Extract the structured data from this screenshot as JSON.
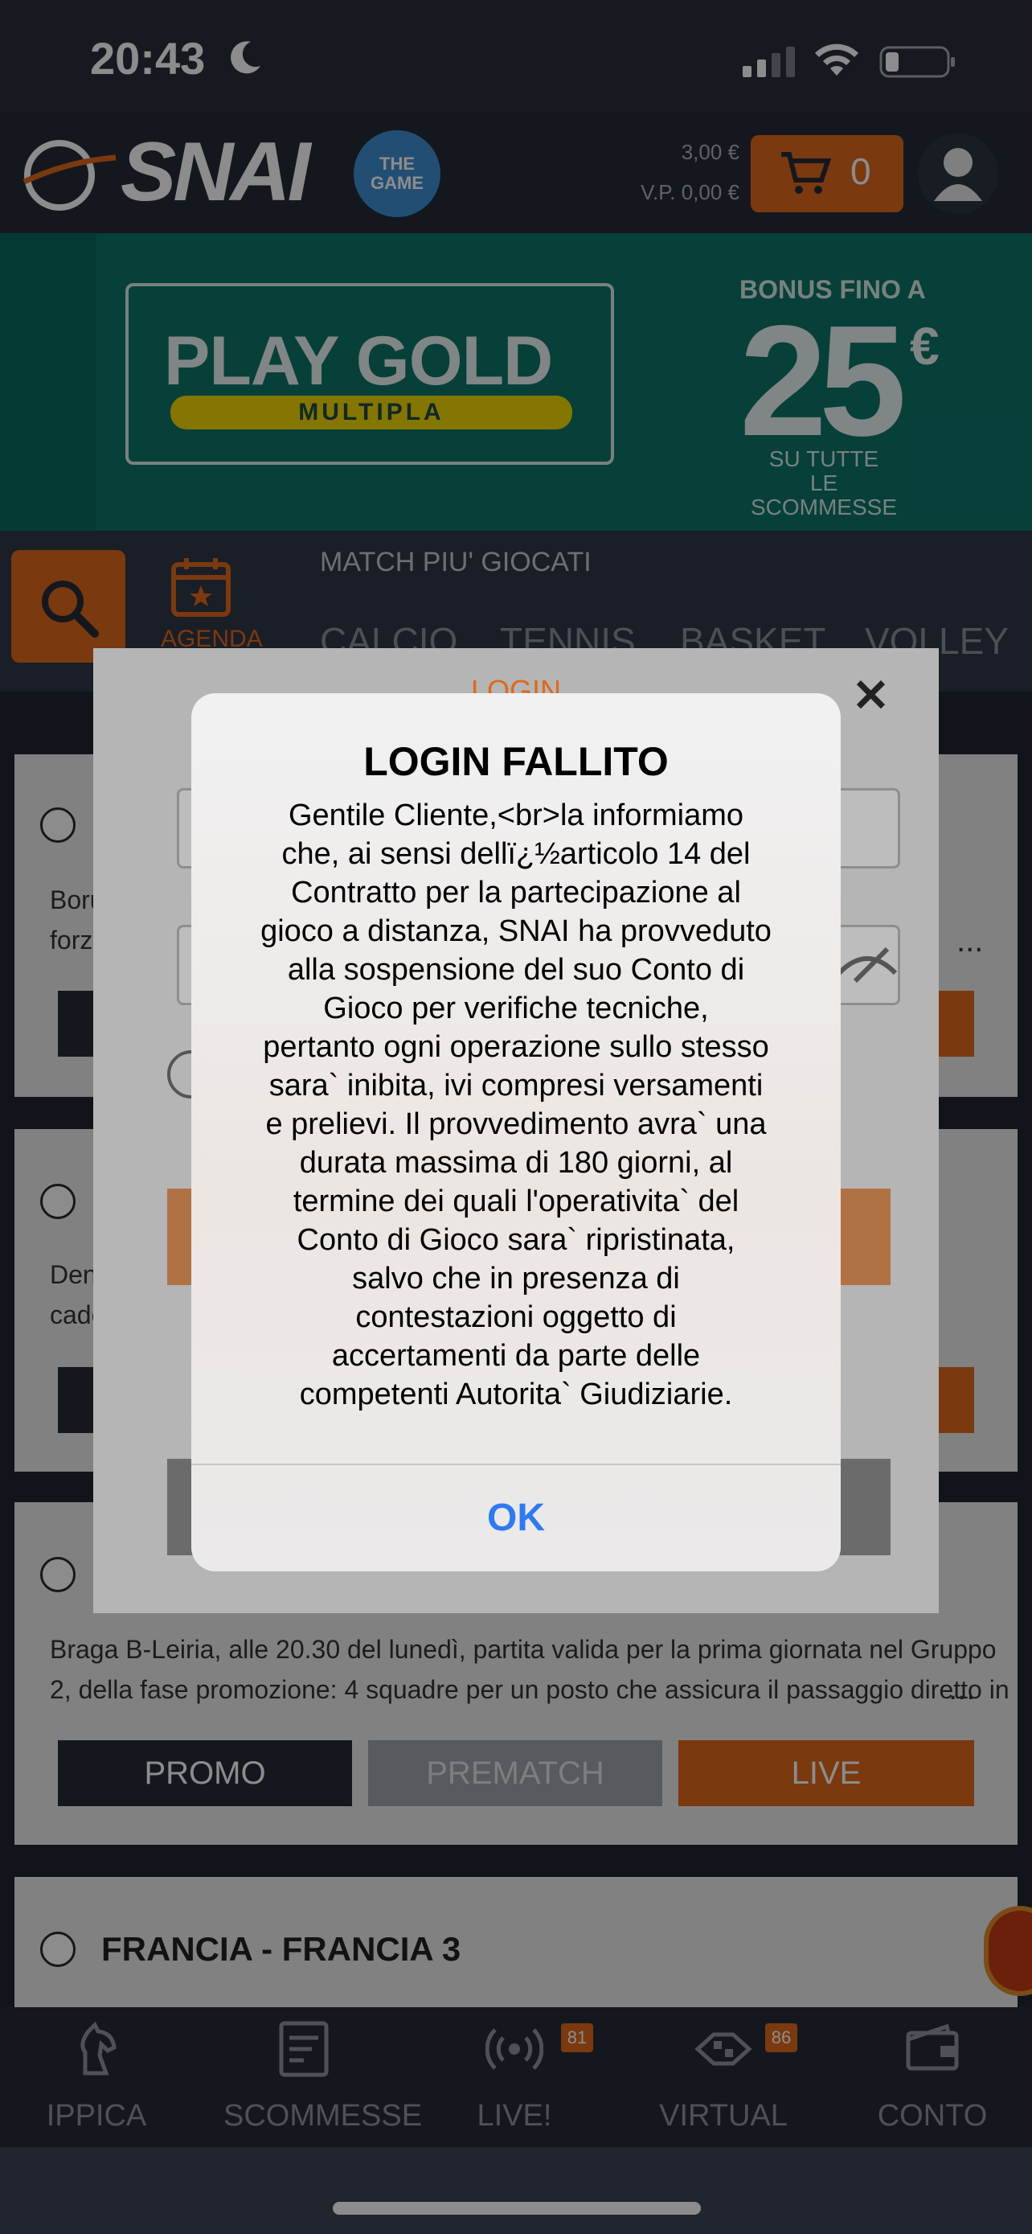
{
  "status_bar": {
    "time": "20:43",
    "moon_icon": "moon-icon",
    "signal_icon": "cellular-signal-icon",
    "wifi_icon": "wifi-icon",
    "battery_icon": "battery-icon"
  },
  "header": {
    "logo_text": "SNAI",
    "game_badge": "THE GAME",
    "balance": "3,00 €",
    "vp_balance": "V.P. 0,00 €",
    "cart_count": "0",
    "accent_color": "#e0681c"
  },
  "banner": {
    "title": "PLAY GOLD",
    "subtitle": "MULTIPLA",
    "bonus_top": "BONUS FINO A",
    "bonus_amount": "25",
    "bonus_currency": "€",
    "bonus_line1": "SU TUTTE",
    "bonus_line2": "LE SCOMMESSE"
  },
  "nav": {
    "agenda_label": "AGENDA",
    "match_label": "MATCH PIU' GIOCATI",
    "sport_tabs": [
      "CALCIO",
      "TENNIS",
      "BASKET",
      "VOLLEY"
    ]
  },
  "cards": [
    {
      "text_line1": "Boru",
      "text_line2": "forza"
    },
    {
      "text_line1": "Den",
      "text_line2": "cade"
    },
    {
      "text_line1": "Braga B-Leiria, alle 20.30 del lunedì, partita valida per la prima giornata nel Gruppo",
      "text_line2": "2, della fase promozione: 4 squadre per un posto che assicura il passaggio diretto in",
      "buttons": [
        "PROMO",
        "PREMATCH",
        "LIVE"
      ]
    },
    {
      "title": "FRANCIA - FRANCIA 3"
    }
  ],
  "ellipsis": "...",
  "login_panel": {
    "title": "LOGIN",
    "close": "✕"
  },
  "alert": {
    "title": "LOGIN FALLITO",
    "message_lines": [
      "Gentile Cliente,<br>la informiamo",
      "che, ai sensi dellï¿½articolo 14 del",
      "Contratto per la partecipazione al",
      "gioco a distanza, SNAI ha provveduto",
      "alla sospensione del suo Conto di",
      "Gioco per verifiche tecniche,",
      "pertanto ogni operazione sullo stesso",
      "sara` inibita, ivi compresi versamenti",
      "e prelievi. Il provvedimento avra` una",
      "durata massima di 180 giorni, al",
      "termine dei quali l'operativita` del",
      "Conto di Gioco sara` ripristinata,",
      "salvo che in presenza di",
      "contestazioni oggetto di",
      "accertamenti da parte delle",
      "competenti Autorita` Giudiziarie."
    ],
    "ok_label": "OK"
  },
  "tabbar": [
    {
      "label": "IPPICA",
      "icon": "horse-icon"
    },
    {
      "label": "SCOMMESSE",
      "icon": "ticket-icon"
    },
    {
      "label": "LIVE!",
      "icon": "broadcast-icon",
      "badge": "81"
    },
    {
      "label": "VIRTUAL",
      "icon": "virtual-flag-icon",
      "badge": "86"
    },
    {
      "label": "CONTO",
      "icon": "wallet-icon"
    }
  ]
}
